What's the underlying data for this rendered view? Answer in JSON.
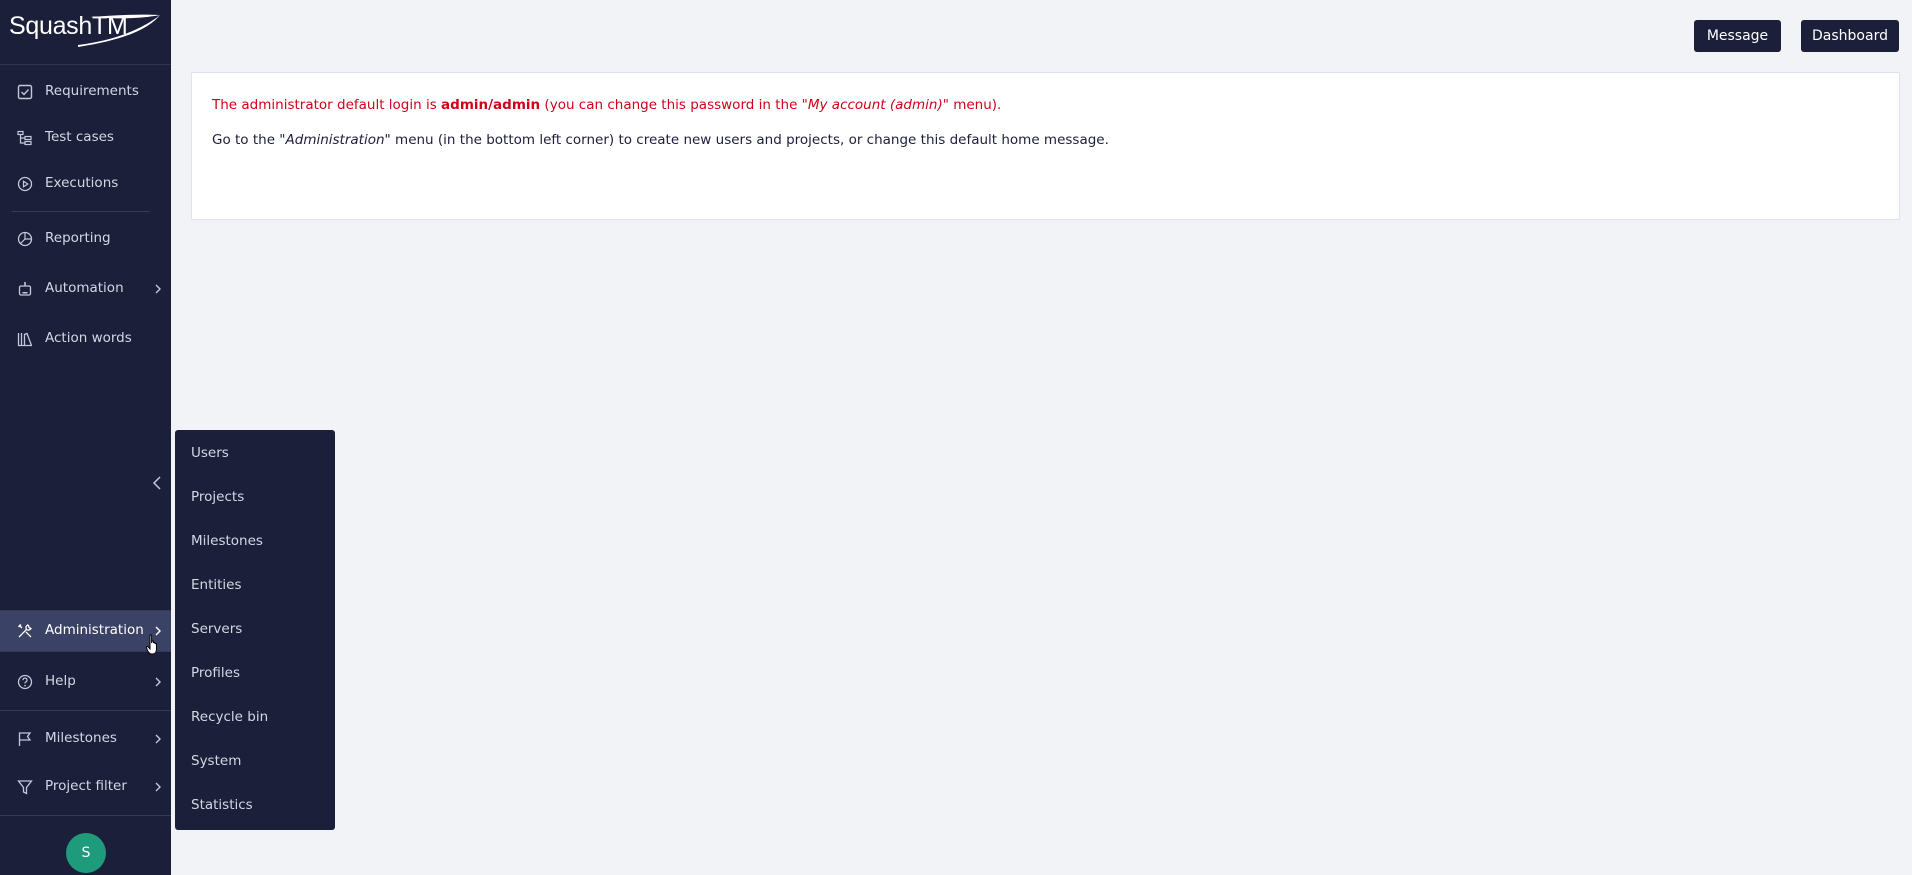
{
  "brand": {
    "name": "SquashTM"
  },
  "sidebar": {
    "items": [
      {
        "label": "Requirements",
        "icon": "checkbox-icon"
      },
      {
        "label": "Test cases",
        "icon": "tree-icon"
      },
      {
        "label": "Executions",
        "icon": "play-circle-icon"
      },
      {
        "label": "Reporting",
        "icon": "pie-chart-icon"
      },
      {
        "label": "Automation",
        "icon": "robot-icon"
      },
      {
        "label": "Action words",
        "icon": "library-icon"
      }
    ],
    "bottom_items": [
      {
        "label": "Administration",
        "icon": "tools-icon"
      },
      {
        "label": "Help",
        "icon": "help-circle-icon"
      },
      {
        "label": "Milestones",
        "icon": "flag-icon"
      },
      {
        "label": "Project filter",
        "icon": "filter-icon"
      }
    ],
    "avatar_initial": "S"
  },
  "header": {
    "message_button": "Message",
    "dashboard_button": "Dashboard"
  },
  "home_message": {
    "line1_part1": "The administrator default login is ",
    "line1_bold": "admin/admin",
    "line1_part2": " (you can change this password in the \"",
    "line1_italic": "My account (admin)",
    "line1_part3": "\" menu).",
    "line2_part1": "Go to the \"",
    "line2_italic": "Administration",
    "line2_part2": "\" menu (in the bottom left corner) to create new users and projects, or change this default home message."
  },
  "admin_submenu": {
    "items": [
      "Users",
      "Projects",
      "Milestones",
      "Entities",
      "Servers",
      "Profiles",
      "Recycle bin",
      "System",
      "Statistics"
    ]
  },
  "colors": {
    "sidebar_bg": "#1b1f3a",
    "active_item_bg": "#3a4266",
    "error_text": "#d0021b",
    "avatar_bg": "#1e9b7a",
    "page_bg": "#f2f3f7"
  }
}
